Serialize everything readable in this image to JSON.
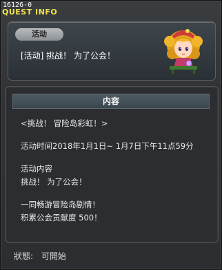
{
  "window": {
    "quest_id": "16126-0",
    "title": "QUEST INFO"
  },
  "event": {
    "tag": "活动",
    "title": "[活动] 挑战！ 为了公会！"
  },
  "content": {
    "header": "内容",
    "lines": [
      "<挑战！ 冒险岛彩虹！>",
      "活动时间2018年1月1日~ 1月7日下午11点59分",
      "活动内容",
      "挑战！ 为了公会！",
      "一同畅游冒险岛剧情！",
      "积累公会贡献度 500！"
    ]
  },
  "status": {
    "label": "狀態:",
    "value": "可開始"
  }
}
